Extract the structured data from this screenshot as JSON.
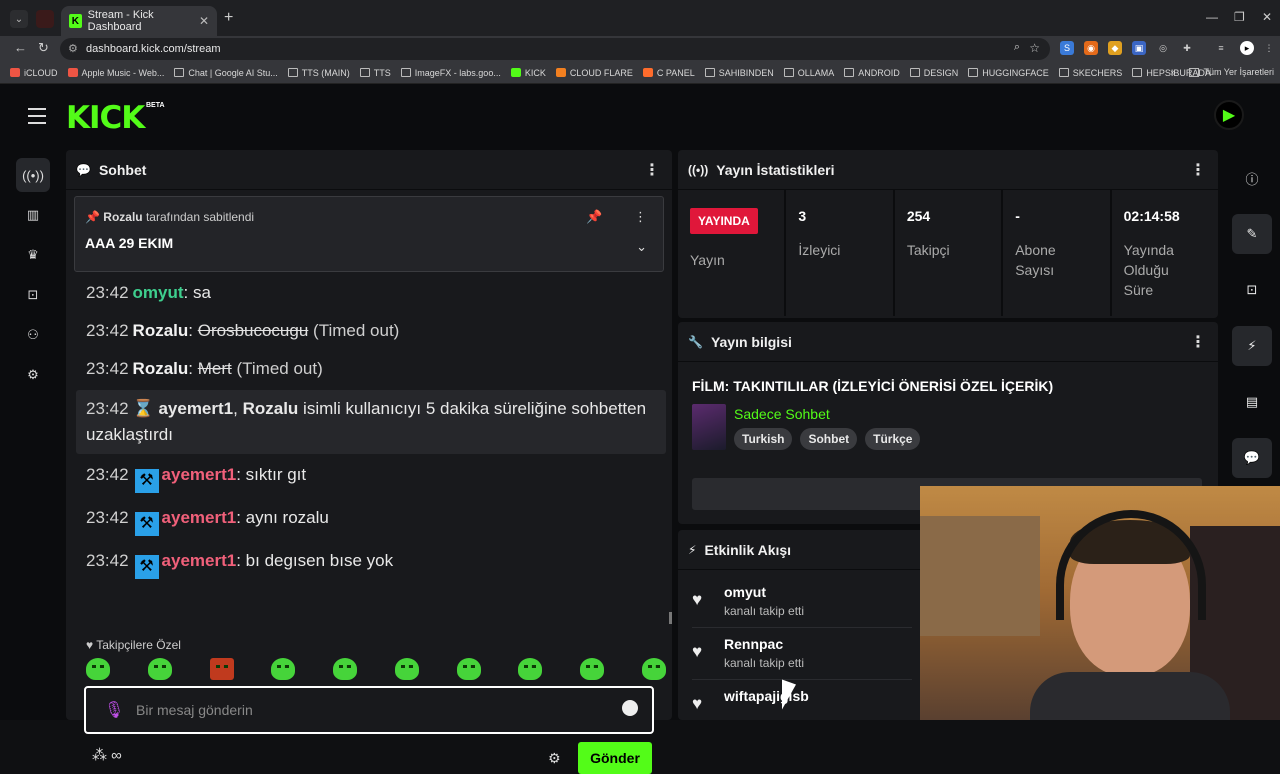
{
  "browser": {
    "tab_title": "Stream - Kick Dashboard",
    "url": "dashboard.kick.com/stream",
    "bookmarks": [
      "iCLOUD",
      "Apple Music - Web...",
      "Chat | Google AI Stu...",
      "TTS (MAIN)",
      "TTS",
      "ImageFX - labs.goo...",
      "KICK",
      "CLOUD FLARE",
      "C PANEL",
      "SAHIBINDEN",
      "OLLAMA",
      "ANDROID",
      "DESIGN",
      "HUGGINGFACE",
      "SKECHERS",
      "HEPSIBURADA"
    ],
    "all_bookmarks": "Tüm Yer İşaretleri"
  },
  "app": {
    "logo": "KICK",
    "beta": "BETA"
  },
  "chat": {
    "title": "Sohbet",
    "pinned_by": "Rozalu",
    "pinned_suffix": "tarafından sabitlendi",
    "pinned_text": "AAA 29 EKIM",
    "messages": [
      {
        "time": "23:42",
        "user": "omyut",
        "sep": ": ",
        "text": "sa"
      },
      {
        "time": "23:42",
        "user": "Rozalu",
        "sep": ": ",
        "text": "Orosbucocugu",
        "note": "(Timed out)"
      },
      {
        "time": "23:42",
        "user": "Rozalu",
        "sep": ": ",
        "text": "Mert",
        "note": "(Timed out)"
      },
      {
        "time": "23:42",
        "user": "ayemert1",
        "sep": ", ",
        "target": "Rozalu",
        "text": "isimli kullanıcıyı 5 dakika süreliğine sohbetten uzaklaştırdı"
      },
      {
        "time": "23:42",
        "user": "ayemert1",
        "sep": ": ",
        "text": "sıktır gıt"
      },
      {
        "time": "23:42",
        "user": "ayemert1",
        "sep": ": ",
        "text": "aynı rozalu"
      },
      {
        "time": "23:42",
        "user": "ayemert1",
        "sep": ": ",
        "text": "bı degısen bıse yok"
      }
    ],
    "emotes_title": "Takipçilere Özel",
    "input_placeholder": "Bir mesaj gönderin",
    "send_label": "Gönder",
    "footer": "∞"
  },
  "stats": {
    "title": "Yayın İstatistikleri",
    "live_badge": "YAYINDA",
    "cells": [
      {
        "value": "",
        "label": "Yayın"
      },
      {
        "value": "3",
        "label": "İzleyici"
      },
      {
        "value": "254",
        "label": "Takipçi"
      },
      {
        "value": "-",
        "label": "Abone Sayısı"
      },
      {
        "value": "02:14:58",
        "label": "Yayında Olduğu Süre"
      }
    ]
  },
  "info": {
    "title": "Yayın bilgisi",
    "film": "FİLM: TAKINTILILAR (İZLEYİCİ ÖNERİSİ ÖZEL İÇERİK)",
    "category": "Sadece Sohbet",
    "tags": [
      "Turkish",
      "Sohbet",
      "Türkçe"
    ]
  },
  "activity": {
    "title": "Etkinlik Akışı",
    "items": [
      {
        "name": "omyut",
        "desc": "kanalı takip etti"
      },
      {
        "name": "Rennpac",
        "desc": "kanalı takip etti"
      },
      {
        "name": "wiftapajigisb",
        "desc": ""
      }
    ]
  },
  "colors": {
    "accent": "#53fc18",
    "live": "#e0173a",
    "omyut": "#3ecf8e",
    "ayemert1": "#f0607a",
    "Rozalu": "#f2f2f2"
  }
}
